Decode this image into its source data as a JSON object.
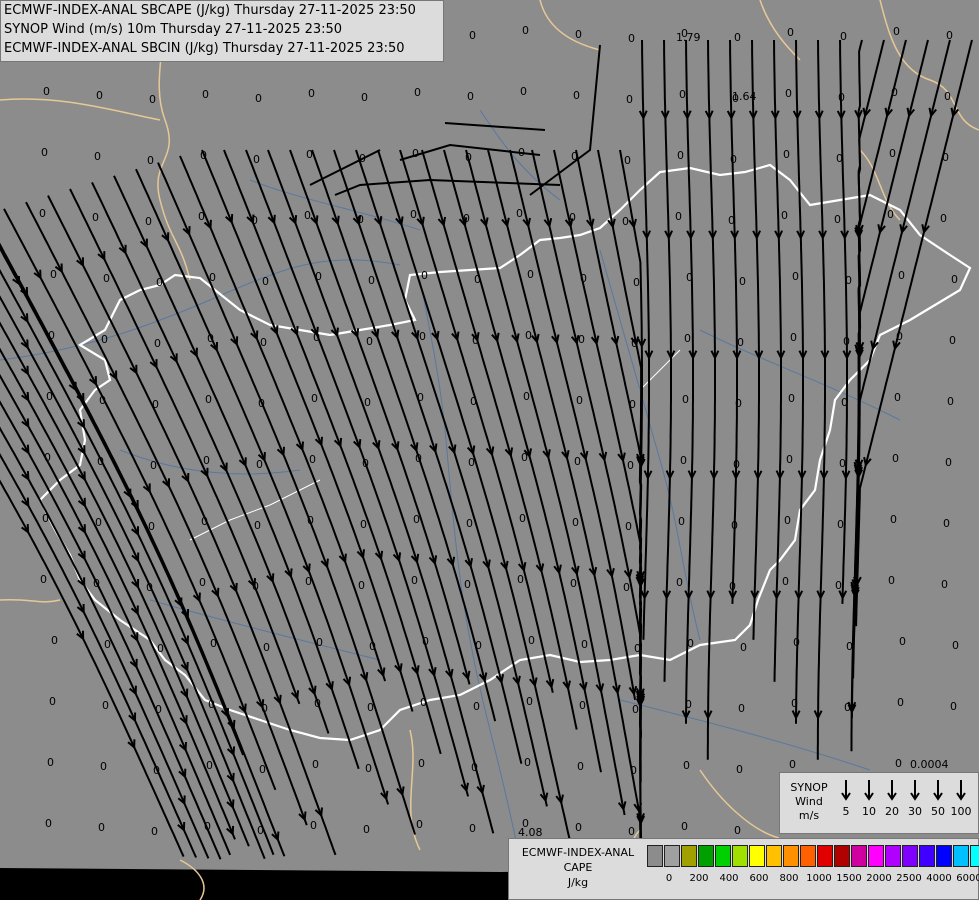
{
  "titles": [
    "ECMWF-INDEX-ANAL SBCAPE (J/kg) Thursday 27-11-2025 23:50",
    "SYNOP Wind (m/s) 10m Thursday 27-11-2025 23:50",
    "ECMWF-INDEX-ANAL SBCIN (J/kg) Thursday 27-11-2025 23:50"
  ],
  "colors": {
    "background": "#8c8c8c",
    "streamline": "#000000",
    "hungary_border": "#ffffff",
    "country_border": "#e6c896",
    "river": "#5a78a0"
  },
  "station_values": [
    "0.0004",
    "1.79",
    "1.64",
    "4.08"
  ],
  "wind_legend": {
    "label_line1": "SYNOP",
    "label_line2": "Wind",
    "label_line3": "m/s",
    "speeds": [
      "5",
      "10",
      "20",
      "30",
      "50",
      "100"
    ]
  },
  "cape_legend": {
    "label_line1": "ECMWF-INDEX-ANAL",
    "label_line2": "CAPE",
    "label_line3": "J/kg",
    "swatch_colors": [
      "#8c8c8c",
      "#a0a0a0",
      "#a0a000",
      "#00a000",
      "#00d000",
      "#a0e000",
      "#ffff00",
      "#ffc000",
      "#ff9000",
      "#ff6000",
      "#e00000",
      "#b00000",
      "#d000a0",
      "#ff00ff",
      "#b000ff",
      "#8000ff",
      "#4000ff",
      "#0000ff",
      "#00c0ff",
      "#00ffff",
      "#ffffff"
    ],
    "tick_labels": [
      "0",
      "200",
      "400",
      "600",
      "800",
      "1000",
      "1500",
      "2000",
      "2500",
      "4000",
      "6000"
    ]
  }
}
